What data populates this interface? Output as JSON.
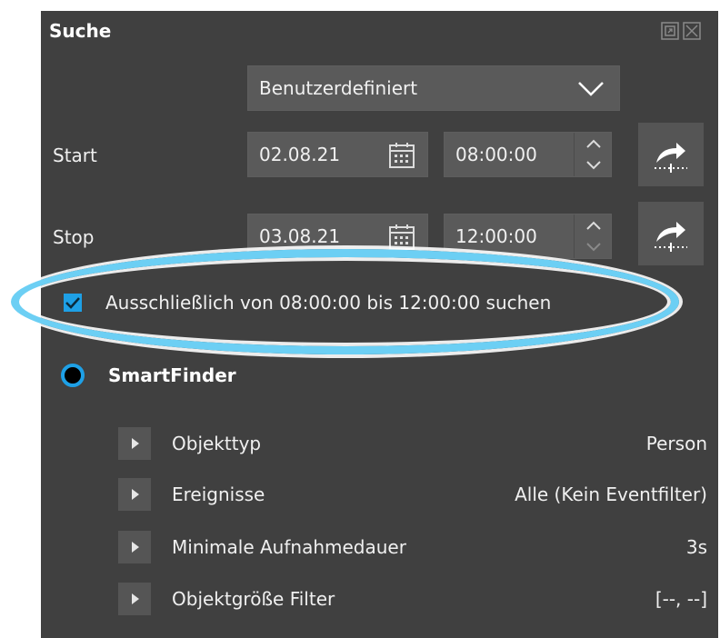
{
  "panel": {
    "title": "Suche"
  },
  "search": {
    "range_preset": "Benutzerdefiniert",
    "start": {
      "label": "Start",
      "date": "02.08.21",
      "time": "08:00:00"
    },
    "stop": {
      "label": "Stop",
      "date": "03.08.21",
      "time": "12:00:00"
    },
    "exclusive_checkbox": {
      "label": "Ausschließlich von 08:00:00 bis 12:00:00 suchen",
      "checked": true
    },
    "smartfinder": {
      "label": "SmartFinder",
      "selected": true
    }
  },
  "filters": [
    {
      "name": "Objekttyp",
      "value": "Person"
    },
    {
      "name": "Ereignisse",
      "value": "Alle (Kein Eventfilter)"
    },
    {
      "name": "Minimale Aufnahmedauer",
      "value": "3s"
    },
    {
      "name": "Objektgröße Filter",
      "value": "[--, --]"
    }
  ],
  "colors": {
    "panel_bg": "#404040",
    "field_bg": "#5a5a5a",
    "accent": "#1ea0e6",
    "highlight": "#6ccff4"
  },
  "icons": {
    "dropdown": "chevron-down-icon",
    "calendar": "calendar-icon",
    "spinner": "up-down-spinner-icon",
    "jump": "jump-to-time-icon",
    "expand": "triangle-right-icon",
    "window": [
      "undock-icon",
      "close-icon"
    ]
  }
}
